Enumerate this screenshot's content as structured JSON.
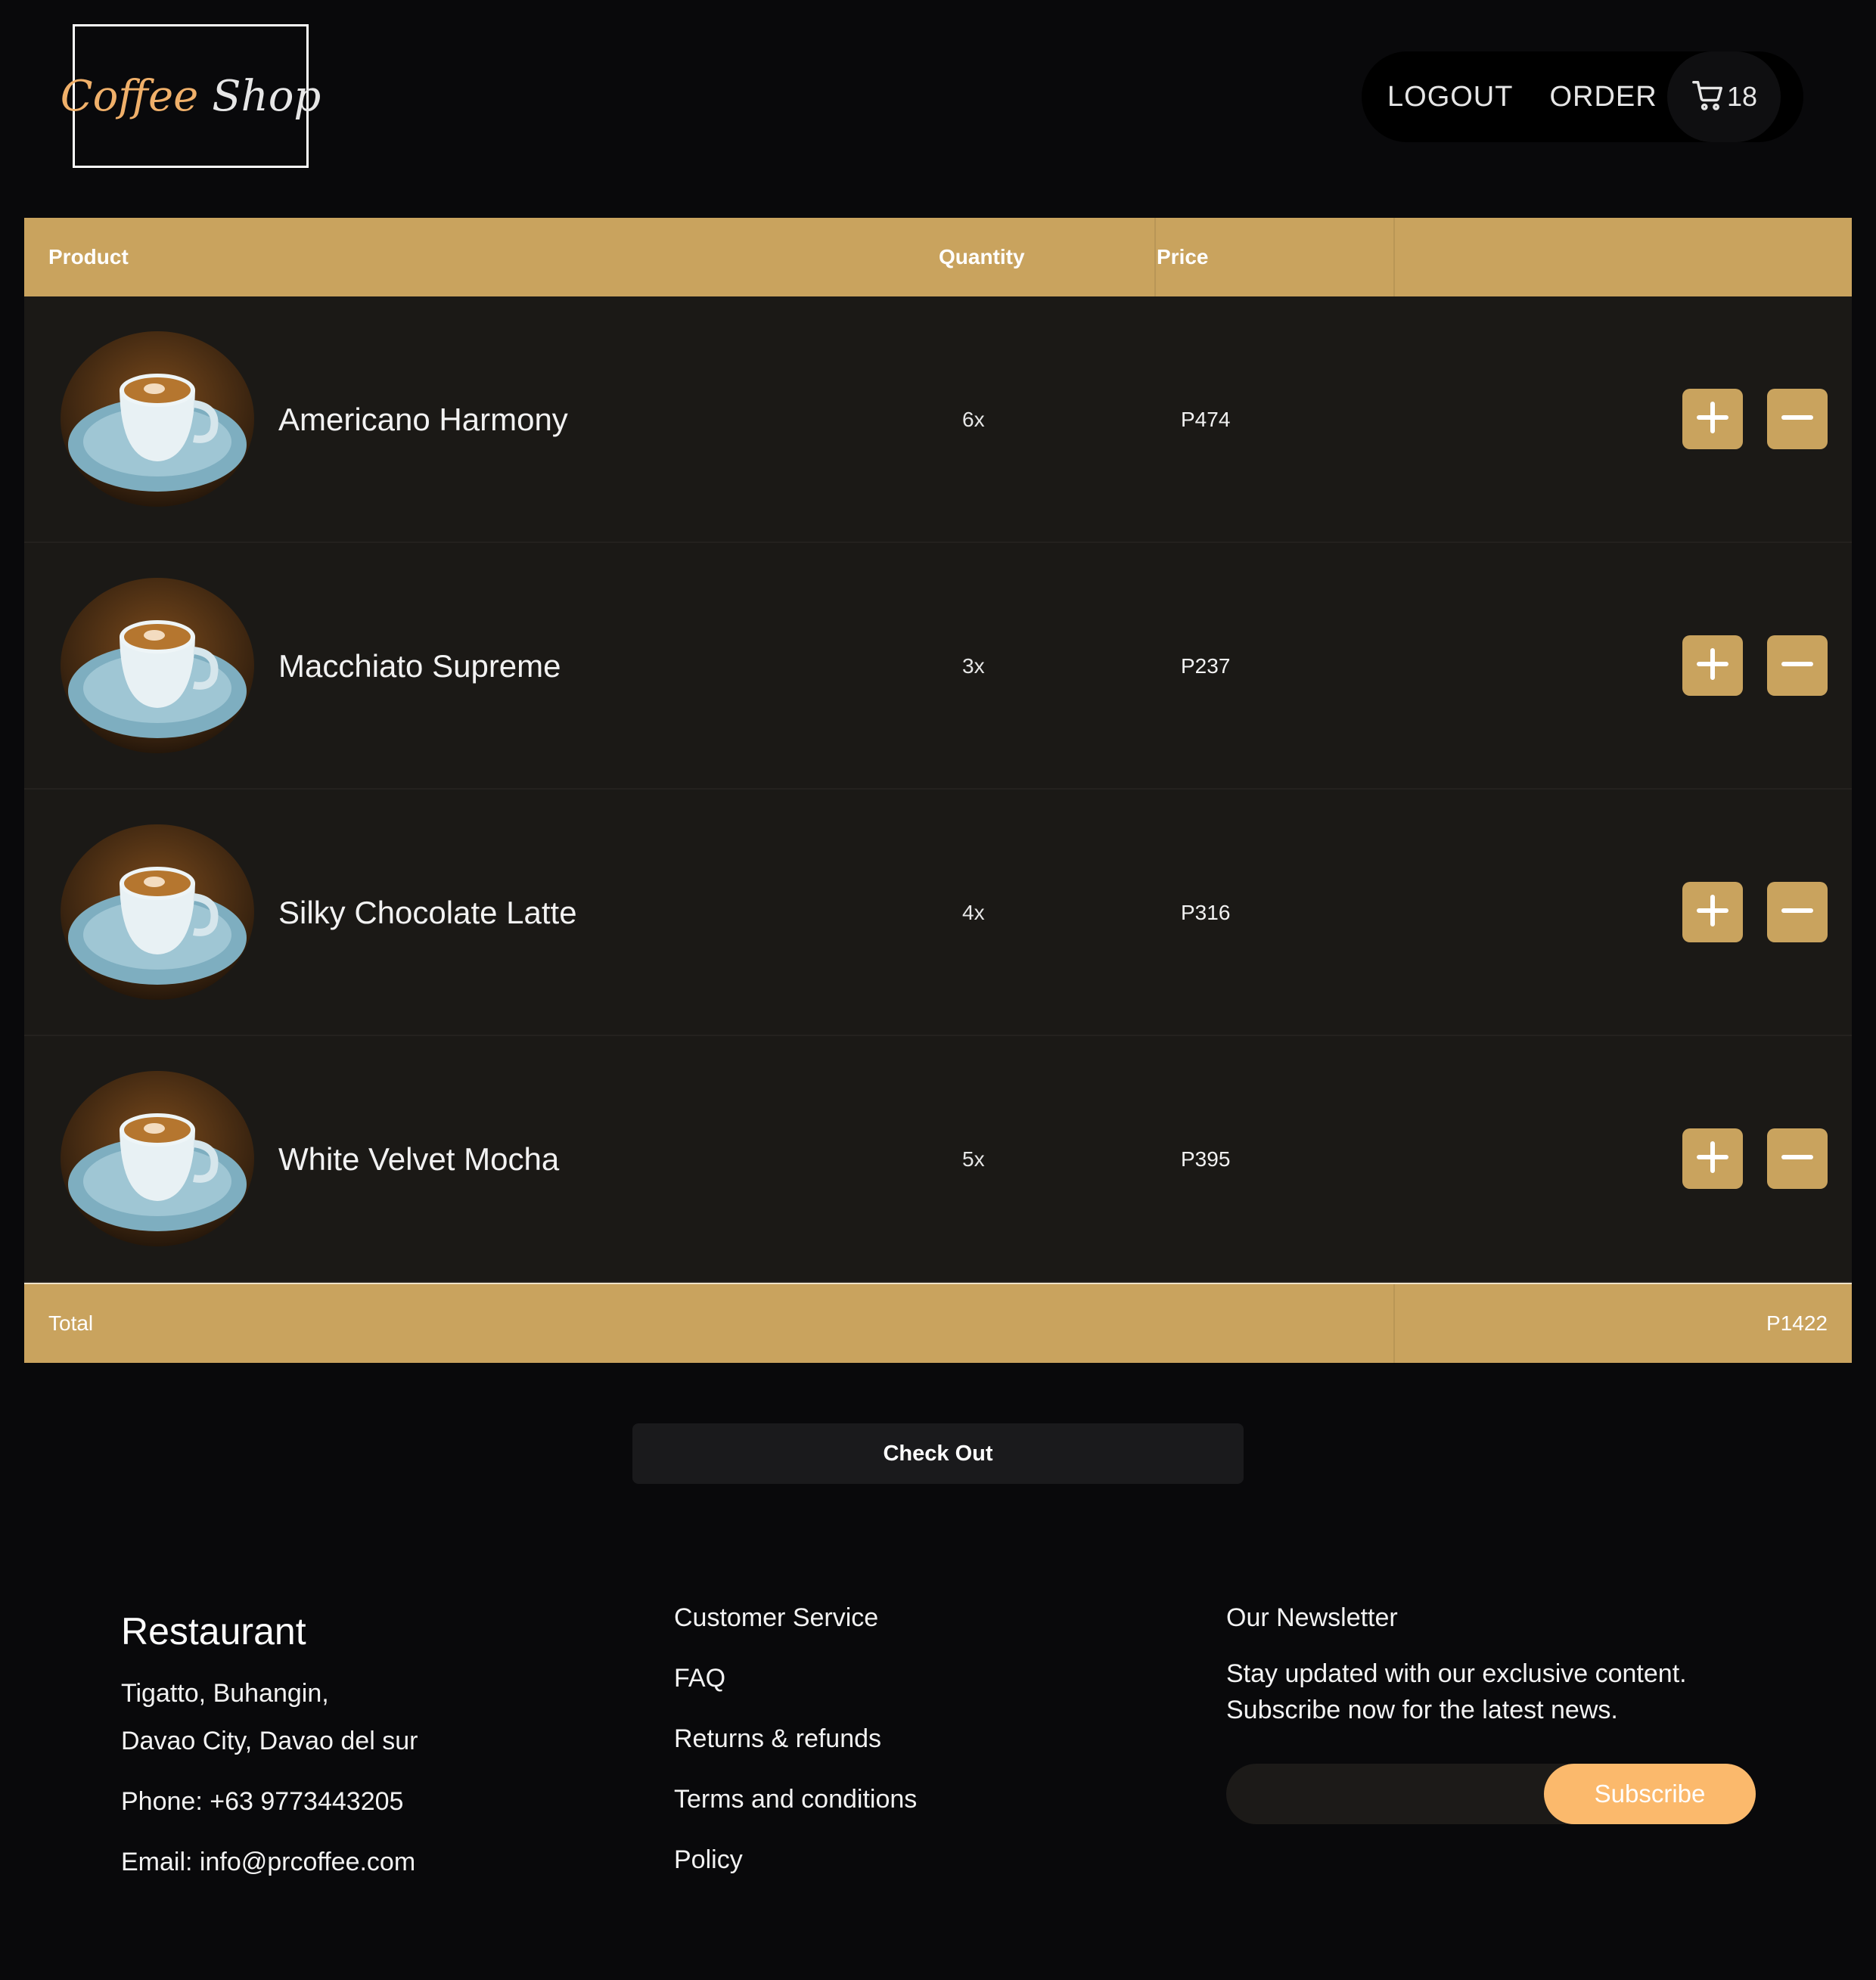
{
  "header": {
    "logo_word1": "Coffee",
    "logo_word2": "Shop",
    "nav": {
      "logout": "LOGOUT",
      "order": "ORDER",
      "cart_count": "18",
      "cart_icon": "cart-icon"
    }
  },
  "table": {
    "headers": {
      "product": "Product",
      "quantity": "Quantity",
      "price": "Price"
    },
    "rows": [
      {
        "name": "Americano Harmony",
        "qty": "6x",
        "price": "P474"
      },
      {
        "name": "Macchiato Supreme",
        "qty": "3x",
        "price": "P237"
      },
      {
        "name": "Silky Chocolate Latte",
        "qty": "4x",
        "price": "P316"
      },
      {
        "name": "White Velvet Mocha",
        "qty": "5x",
        "price": "P395"
      }
    ],
    "total_label": "Total",
    "total_value": "P1422"
  },
  "checkout_label": "Check Out",
  "footer": {
    "restaurant": {
      "title": "Restaurant",
      "address1": "Tigatto, Buhangin,",
      "address2": "Davao City, Davao del sur",
      "phone": "Phone: +63 9773443205",
      "email": "Email: info@prcoffee.com"
    },
    "service": {
      "title": "Customer Service",
      "links": [
        "FAQ",
        "Returns & refunds",
        "Terms and conditions",
        "Policy"
      ]
    },
    "newsletter": {
      "title": "Our Newsletter",
      "text": "Stay updated with our exclusive content. Subscribe now for the latest news.",
      "input_value": "",
      "button": "Subscribe"
    }
  },
  "colors": {
    "accent": "#c9a35e",
    "brand_orange": "#f0b06a",
    "subscribe": "#fbb96c",
    "background": "#09090b",
    "row_bg": "#1b1916"
  }
}
